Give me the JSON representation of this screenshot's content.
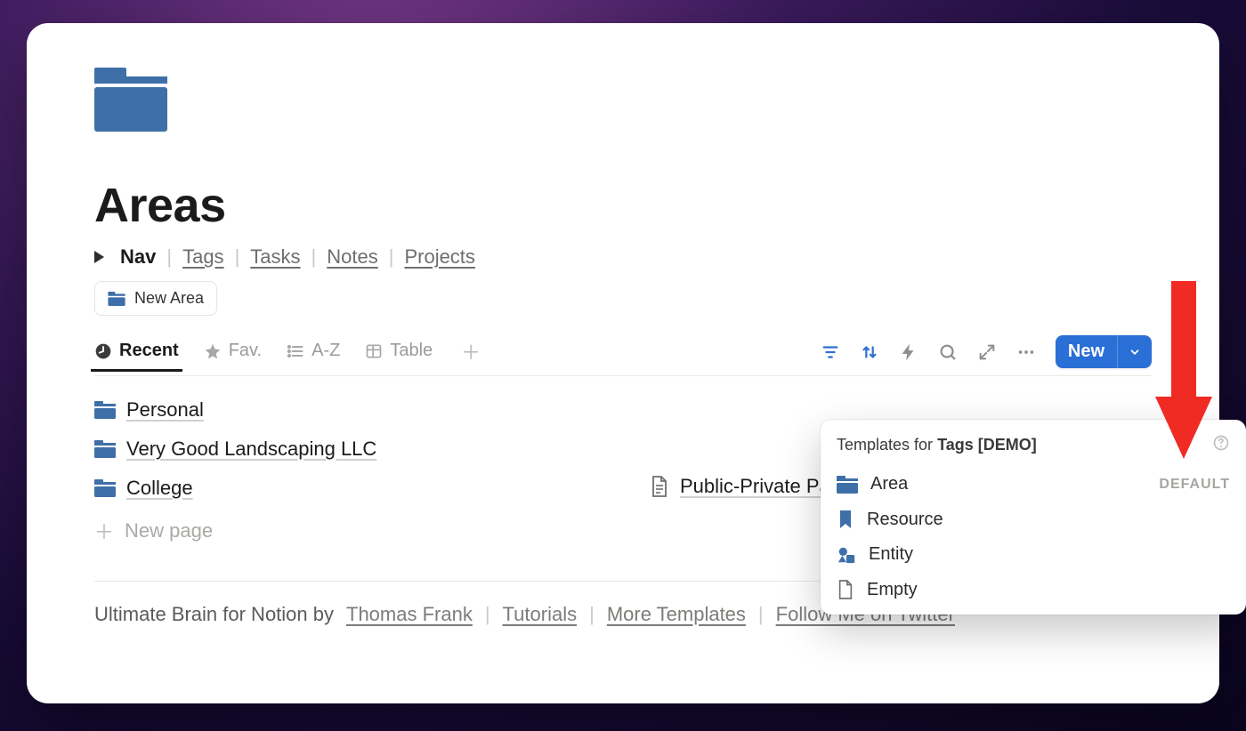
{
  "page": {
    "title": "Areas"
  },
  "nav": {
    "active": "Nav",
    "items": [
      "Tags",
      "Tasks",
      "Notes",
      "Projects"
    ]
  },
  "new_area_button": {
    "label": "New Area"
  },
  "views": {
    "tabs": [
      {
        "icon": "clock",
        "label": "Recent",
        "active": true
      },
      {
        "icon": "star",
        "label": "Fav."
      },
      {
        "icon": "list",
        "label": "A-Z"
      },
      {
        "icon": "table",
        "label": "Table"
      }
    ]
  },
  "new_button": {
    "label": "New"
  },
  "list": {
    "left": [
      {
        "label": "Personal"
      },
      {
        "label": "Very Good Landscaping LLC"
      },
      {
        "label": "College"
      }
    ],
    "right": [
      {
        "label": "Public-Private Part"
      }
    ],
    "new_page_label": "New page"
  },
  "footer": {
    "prefix": "Ultimate Brain for Notion by",
    "author": "Thomas Frank",
    "links": [
      "Tutorials",
      "More Templates",
      "Follow Me on Twitter"
    ]
  },
  "popover": {
    "title_prefix": "Templates for",
    "title_bold": "Tags [DEMO]",
    "default_badge": "DEFAULT",
    "options": [
      {
        "icon": "folder",
        "label": "Area",
        "default": true
      },
      {
        "icon": "bookmark",
        "label": "Resource"
      },
      {
        "icon": "entity",
        "label": "Entity"
      },
      {
        "icon": "page",
        "label": "Empty"
      }
    ]
  }
}
